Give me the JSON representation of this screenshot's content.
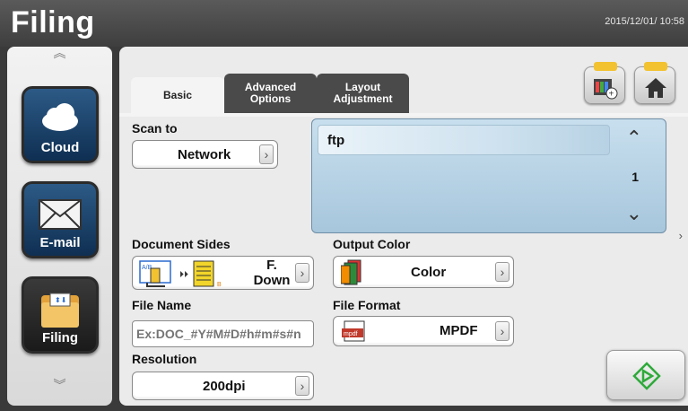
{
  "header": {
    "title": "Filing",
    "datetime": "2015/12/01/ 10:58"
  },
  "sidebar": {
    "items": [
      {
        "label": "Cloud",
        "icon": "cloud-icon"
      },
      {
        "label": "E-mail",
        "icon": "envelope-icon"
      },
      {
        "label": "Filing",
        "icon": "folder-icon"
      }
    ]
  },
  "tabs": [
    {
      "label": "Basic",
      "active": true
    },
    {
      "label": "Advanced\nOptions",
      "active": false
    },
    {
      "label": "Layout\nAdjustment",
      "active": false
    }
  ],
  "scan_to": {
    "label": "Scan to",
    "value": "Network"
  },
  "destination": {
    "selected": "ftp",
    "count": "1"
  },
  "document_sides": {
    "label": "Document Sides",
    "value_line1": "F.",
    "value_line2": "Down",
    "badge_a": "A/B",
    "badge_b": "B"
  },
  "output_color": {
    "label": "Output Color",
    "value": "Color"
  },
  "file_name": {
    "label": "File Name",
    "placeholder": "Ex:DOC_#Y#M#D#h#m#s#n"
  },
  "file_format": {
    "label": "File Format",
    "value": "MPDF",
    "icon_text": "mpdf"
  },
  "resolution": {
    "label": "Resolution",
    "value": "200dpi"
  },
  "colors": {
    "accent_yellow": "#f2c230",
    "scan_green": "#2eaa3a",
    "sidebar_blue": "#1b4a78"
  }
}
